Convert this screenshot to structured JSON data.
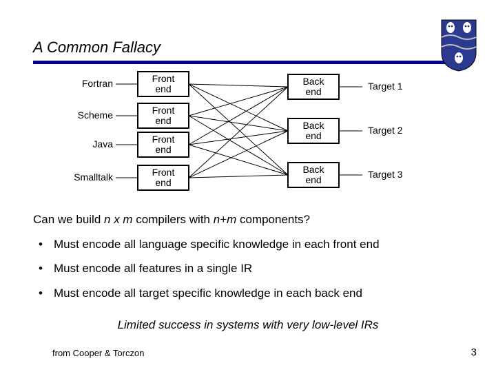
{
  "title": "A Common Fallacy",
  "diagram": {
    "languages": [
      "Fortran",
      "Scheme",
      "Java",
      "Smalltalk"
    ],
    "front_label": "Front end",
    "back_label": "Back end",
    "targets": [
      "Target 1",
      "Target 2",
      "Target 3"
    ]
  },
  "question": {
    "prefix": "Can we build ",
    "nxm": "n x m",
    "mid": " compilers with ",
    "npm": "n+m",
    "suffix": " components?"
  },
  "bullets": [
    "Must encode all language specific knowledge in each front end",
    "Must encode all features in a single IR",
    "Must encode all target specific knowledge in each back end"
  ],
  "conclusion": "Limited success in systems with very low-level IRs",
  "footer_left": "from Cooper & Torczon",
  "footer_right": "3"
}
